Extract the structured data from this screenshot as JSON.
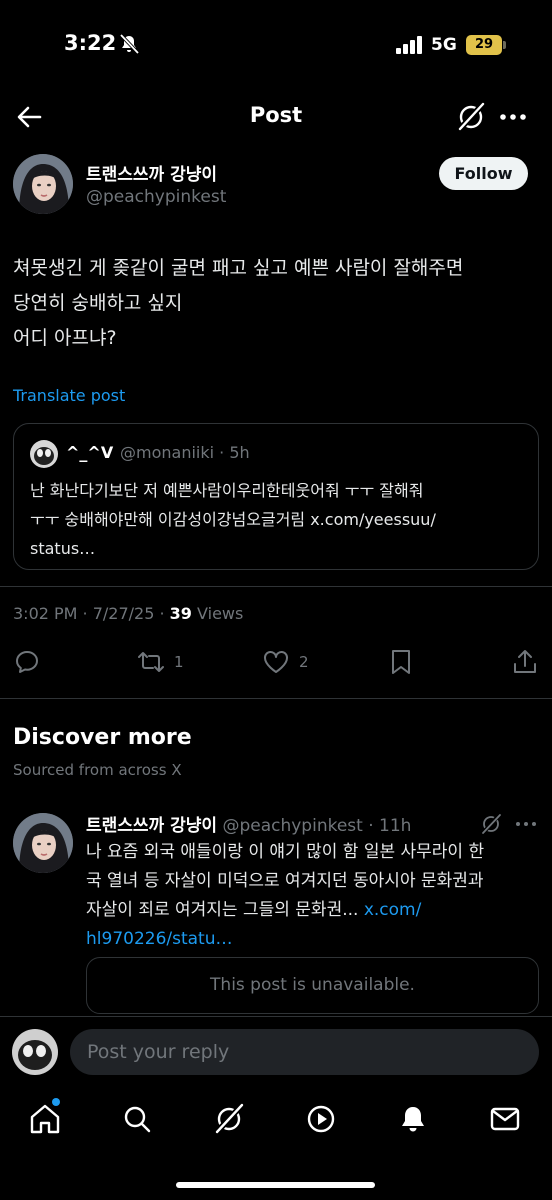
{
  "status": {
    "time": "3:22",
    "network": "5G",
    "battery": "29"
  },
  "header": {
    "title": "Post"
  },
  "post": {
    "author_name": "트랜스쓰까 강냥이",
    "author_handle": "@peachypinkest",
    "follow_label": "Follow",
    "lines": [
      "쳐못생긴 게 좆같이 굴면 패고 싶고 예쁜 사람이 잘해주면",
      "당연히 숭배하고 싶지",
      "어디 아프냐?"
    ],
    "translate_label": "Translate post",
    "quote": {
      "name": "^_^V",
      "handle": "@monaniiki · 5h",
      "lines": [
        "난 화난다기보단 저 예쁜사람이우리한테웃어줘 ㅜㅜ 잘해줘",
        "ㅜㅜ 숭배해야만해 이감성이걍넘오글거림 x.com/yeessuu/",
        "status…"
      ]
    },
    "time_date": "3:02 PM · 7/27/25 · ",
    "views_count": "39",
    "views_label": " Views",
    "actions": {
      "reposts": "1",
      "likes": "2"
    }
  },
  "discover": {
    "title": "Discover more",
    "subtitle": "Sourced from across X",
    "item": {
      "name": "트랜스쓰까 강냥이",
      "handle": " @peachypinkest · 11h",
      "line1": "나 요즘 외국 애들이랑 이 얘기 많이 함 일본 사무라이 한",
      "line2": "국 열녀 등 자살이 미덕으로 여겨지던 동아시아 문화권과",
      "line3_text": "자살이 죄로 여겨지는 그들의 문화권... ",
      "line3_link": "x.com/",
      "line4_link": "hl970226/statu…",
      "unavailable": "This post is unavailable."
    }
  },
  "reply": {
    "placeholder": "Post your reply"
  },
  "nav": {
    "icons": [
      "home-icon",
      "search-icon",
      "grok-icon",
      "video-icon",
      "notifications-icon",
      "messages-icon"
    ]
  },
  "colors": {
    "accent": "#1d9bf0",
    "muted": "#71767b",
    "divider": "#2f3336"
  }
}
